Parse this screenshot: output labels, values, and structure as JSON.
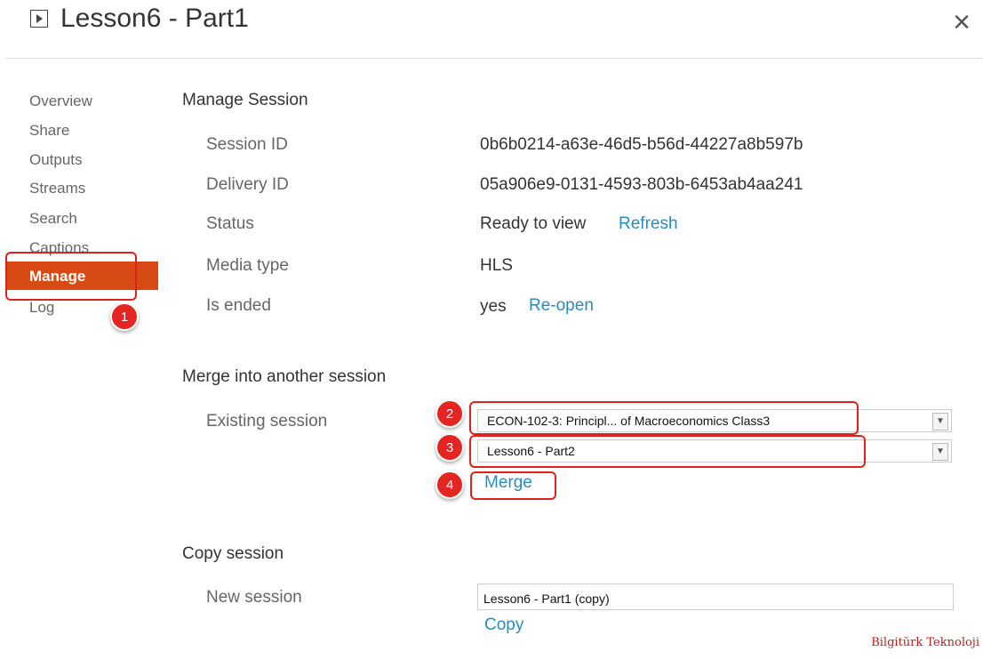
{
  "header": {
    "title": "Lesson6 - Part1",
    "close_glyph": "×"
  },
  "sidebar": {
    "items": [
      {
        "label": "Overview"
      },
      {
        "label": "Share"
      },
      {
        "label": "Outputs"
      },
      {
        "label": "Streams"
      },
      {
        "label": "Search"
      },
      {
        "label": "Captions"
      },
      {
        "label": "Manage",
        "active": true
      },
      {
        "label": "Log"
      }
    ]
  },
  "manage": {
    "title": "Manage Session",
    "rows": [
      {
        "label": "Session ID",
        "value": "0b6b0214-a63e-46d5-b56d-44227a8b597b"
      },
      {
        "label": "Delivery ID",
        "value": "05a906e9-0131-4593-803b-6453ab4aa241"
      },
      {
        "label": "Status",
        "value": "Ready to view",
        "link": "Refresh"
      },
      {
        "label": "Media type",
        "value": "HLS"
      },
      {
        "label": "Is ended",
        "value": "yes",
        "link": "Re-open"
      }
    ]
  },
  "merge": {
    "title": "Merge into another session",
    "label": "Existing session",
    "folder_select": "ECON-102-3: Principl... of Macroeconomics Class3",
    "session_select": "Lesson6 - Part2",
    "merge_link": "Merge"
  },
  "copy": {
    "title": "Copy session",
    "label": "New session",
    "input_value": "Lesson6 - Part1 (copy)",
    "copy_link": "Copy"
  },
  "callouts": [
    "1",
    "2",
    "3",
    "4"
  ],
  "watermark": "Bilgitürk Teknoloji",
  "colors": {
    "accent": "#d84a15",
    "link": "#2a8bbd",
    "callout": "#e52521"
  }
}
